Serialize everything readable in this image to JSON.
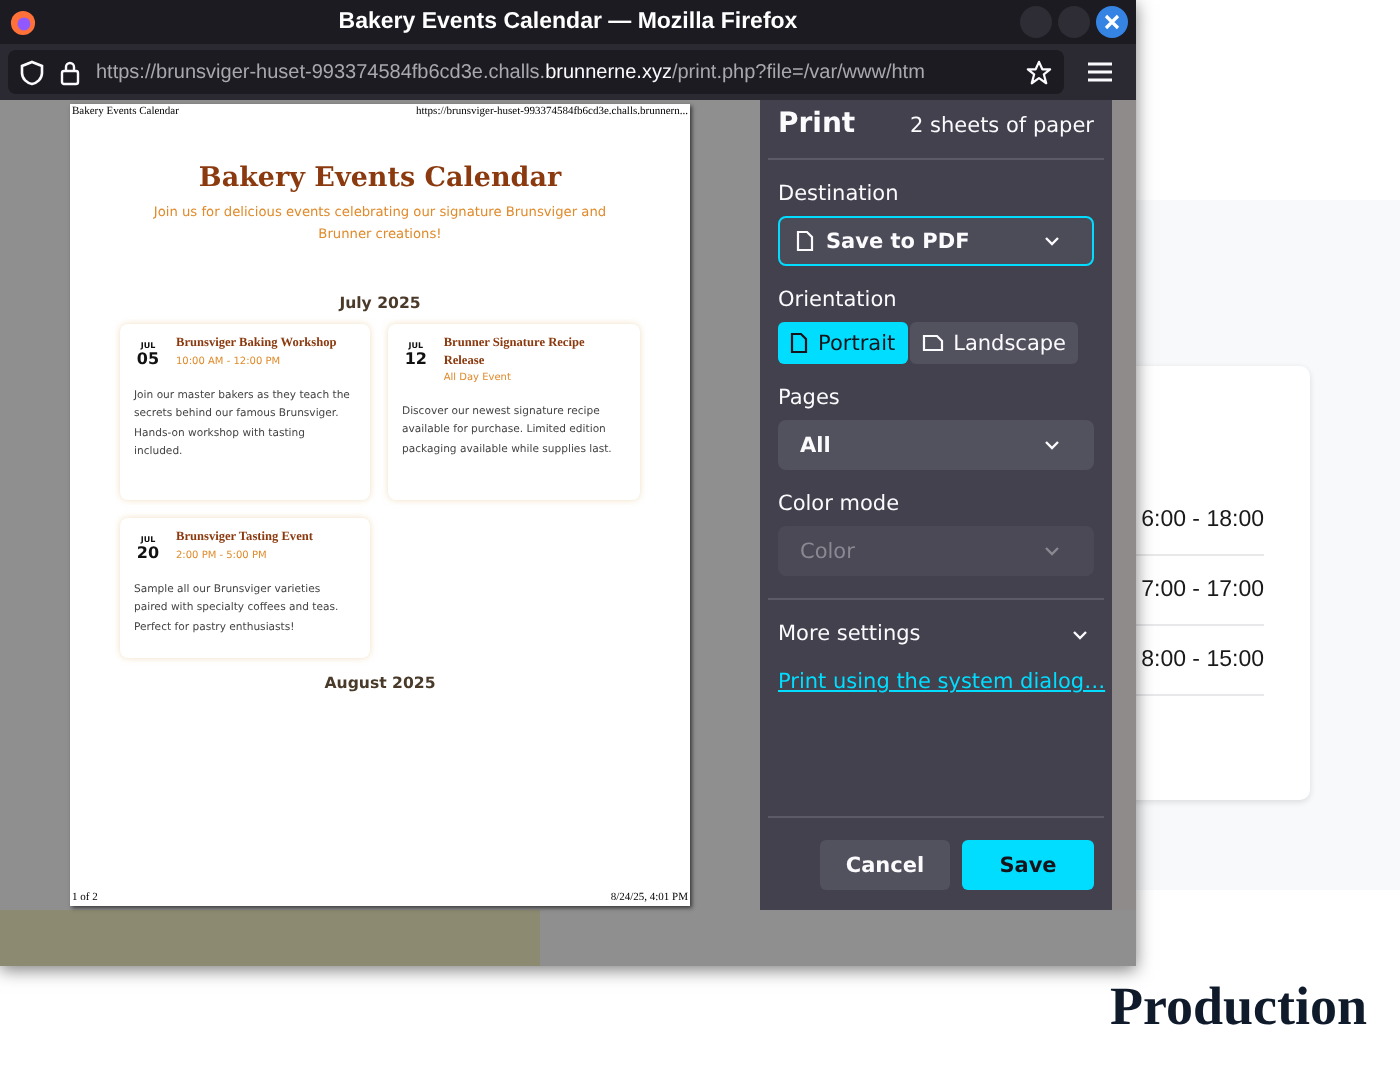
{
  "background_page": {
    "hours": [
      "6:00 - 18:00",
      "7:00 - 17:00",
      "8:00 - 15:00"
    ],
    "heading": "Production"
  },
  "window": {
    "title": "Bakery Events Calendar — Mozilla Firefox",
    "url": {
      "before": "https://brunsviger-huset-993374584fb6cd3e.challs.",
      "host": "brunnerne.xyz",
      "after": "/print.php?file=/var/www/htm"
    }
  },
  "preview": {
    "header_left": "Bakery Events Calendar",
    "header_right": "https://brunsviger-huset-993374584fb6cd3e.challs.brunnern...",
    "title": "Bakery Events Calendar",
    "subtitle": "Join us for delicious events celebrating our signature Brunsviger and Brunner creations!",
    "months": [
      {
        "label": "July 2025",
        "events": [
          {
            "month": "JUL",
            "day": "05",
            "title": "Brunsviger Baking Workshop",
            "time": "10:00 AM - 12:00 PM",
            "description": "Join our master bakers as they teach the secrets behind our famous Brunsviger. Hands-on workshop with tasting included."
          },
          {
            "month": "JUL",
            "day": "12",
            "title": "Brunner Signature Recipe Release",
            "time": "All Day Event",
            "description": "Discover our newest signature recipe available for purchase. Limited edition packaging available while supplies last."
          },
          {
            "month": "JUL",
            "day": "20",
            "title": "Brunsviger Tasting Event",
            "time": "2:00 PM - 5:00 PM",
            "description": "Sample all our Brunsviger varieties paired with specialty coffees and teas. Perfect for pastry enthusiasts!"
          }
        ]
      },
      {
        "label": "August 2025"
      }
    ],
    "footer_left": "1 of 2",
    "footer_right": "8/24/25, 4:01 PM"
  },
  "print_panel": {
    "title": "Print",
    "summary": "2 sheets of paper",
    "settings": [
      {
        "kind": "select",
        "label": "Destination",
        "value": "Save to PDF",
        "focused": true,
        "disabled": false
      },
      {
        "kind": "toggle",
        "label": "Orientation",
        "options": [
          {
            "label": "Portrait",
            "selected": true
          },
          {
            "label": "Landscape",
            "selected": false
          }
        ]
      },
      {
        "kind": "select",
        "label": "Pages",
        "value": "All",
        "focused": false,
        "disabled": false
      },
      {
        "kind": "select",
        "label": "Color mode",
        "value": "Color",
        "focused": false,
        "disabled": true
      }
    ],
    "more_settings": {
      "label": "More settings",
      "expanded": false
    },
    "link": "Print using the system dialog…",
    "buttons": [
      {
        "label": "Cancel",
        "kind": "secondary"
      },
      {
        "label": "Save",
        "kind": "primary"
      }
    ]
  }
}
